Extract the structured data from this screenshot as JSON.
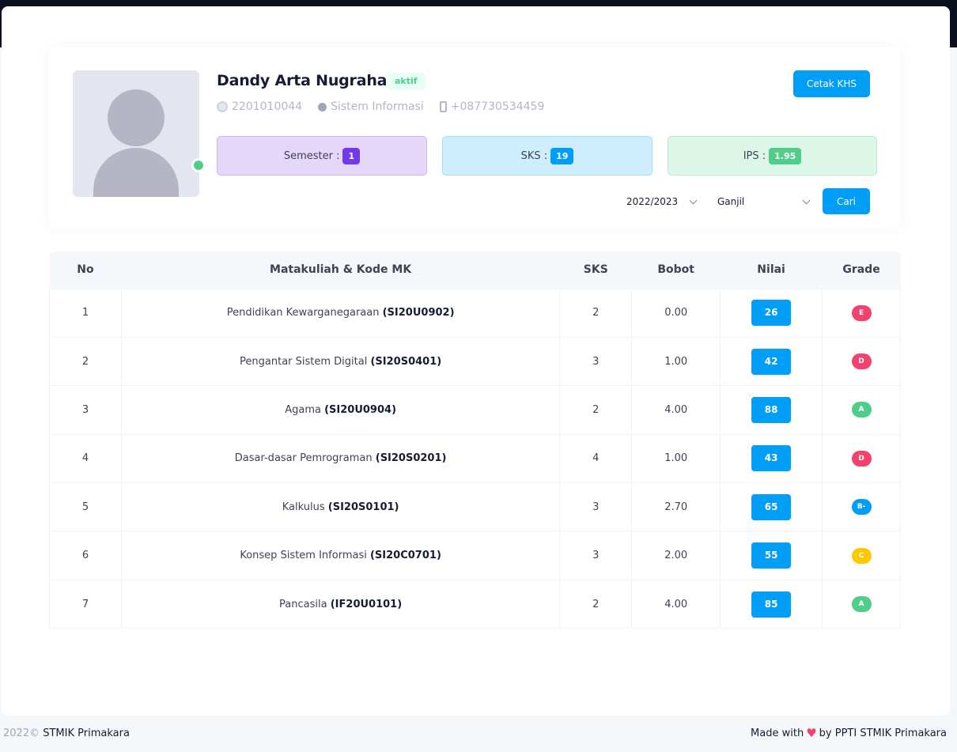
{
  "profile": {
    "name": "Dandy Arta Nugraha",
    "status": "aktif",
    "nim": "2201010044",
    "program": "Sistem Informasi",
    "phone": "+087730534459",
    "print_label": "Cetak KHS"
  },
  "stats": {
    "semester_label": "Semester :",
    "semester_value": "1",
    "sks_label": "SKS :",
    "sks_value": "19",
    "ips_label": "IPS :",
    "ips_value": "1.95"
  },
  "filters": {
    "year": "2022/2023",
    "term": "Ganjil",
    "search_label": "Cari"
  },
  "table": {
    "headers": [
      "No",
      "Matakuliah & Kode MK",
      "SKS",
      "Bobot",
      "Nilai",
      "Grade"
    ],
    "rows": [
      {
        "no": "1",
        "course": "Pendidikan Kewarganegaraan",
        "code": "(SI20U0902)",
        "sks": "2",
        "bobot": "0.00",
        "nilai": "26",
        "grade": "E",
        "grade_color": "#f1416c"
      },
      {
        "no": "2",
        "course": "Pengantar Sistem Digital",
        "code": "(SI20S0401)",
        "sks": "3",
        "bobot": "1.00",
        "nilai": "42",
        "grade": "D",
        "grade_color": "#f1416c"
      },
      {
        "no": "3",
        "course": "Agama",
        "code": "(SI20U0904)",
        "sks": "2",
        "bobot": "4.00",
        "nilai": "88",
        "grade": "A",
        "grade_color": "#50cd89"
      },
      {
        "no": "4",
        "course": "Dasar-dasar Pemrograman",
        "code": "(SI20S0201)",
        "sks": "4",
        "bobot": "1.00",
        "nilai": "43",
        "grade": "D",
        "grade_color": "#f1416c"
      },
      {
        "no": "5",
        "course": "Kalkulus",
        "code": "(SI20S0101)",
        "sks": "3",
        "bobot": "2.70",
        "nilai": "65",
        "grade": "B-",
        "grade_color": "#009ef7"
      },
      {
        "no": "6",
        "course": "Konsep Sistem Informasi",
        "code": "(SI20C0701)",
        "sks": "3",
        "bobot": "2.00",
        "nilai": "55",
        "grade": "C",
        "grade_color": "#ffc700"
      },
      {
        "no": "7",
        "course": "Pancasila",
        "code": "(IF20U0101)",
        "sks": "2",
        "bobot": "4.00",
        "nilai": "85",
        "grade": "A",
        "grade_color": "#50cd89"
      }
    ]
  },
  "footer": {
    "year": "2022©",
    "org": "STMIK Primakara",
    "made_with": "Made with",
    "by": "by PPTI STMIK Primakara"
  },
  "icons": {
    "avatar": "user-placeholder-icon",
    "nim": "user-circle-icon",
    "program": "dot-icon",
    "phone": "phone-icon",
    "heart": "heart-icon"
  }
}
